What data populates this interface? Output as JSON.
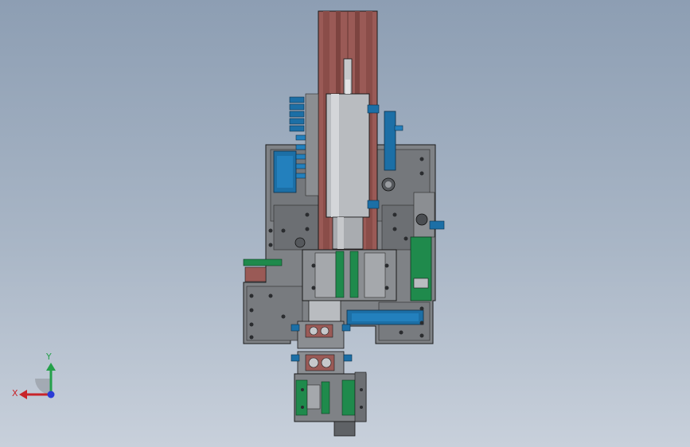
{
  "view": {
    "background_top": "#8d9eb3",
    "background_bottom": "#c8d0db"
  },
  "model": {
    "label": "",
    "part_colors": {
      "cylinder_rail": "#9a5a56",
      "plate_gray": "#7f8286",
      "plate_dark": "#5f6266",
      "steel_light": "#b9bcc0",
      "pneumatic_blue": "#1c6fa6",
      "sensor_green": "#1f8a4c",
      "edge_black": "#1a1a1a"
    }
  },
  "triad": {
    "x_label": "X",
    "y_label": "Y",
    "x_color": "#c8242a",
    "y_color": "#24a04a",
    "z_color": "#2a3bd6",
    "icon": "coordinate-triad-icon"
  }
}
